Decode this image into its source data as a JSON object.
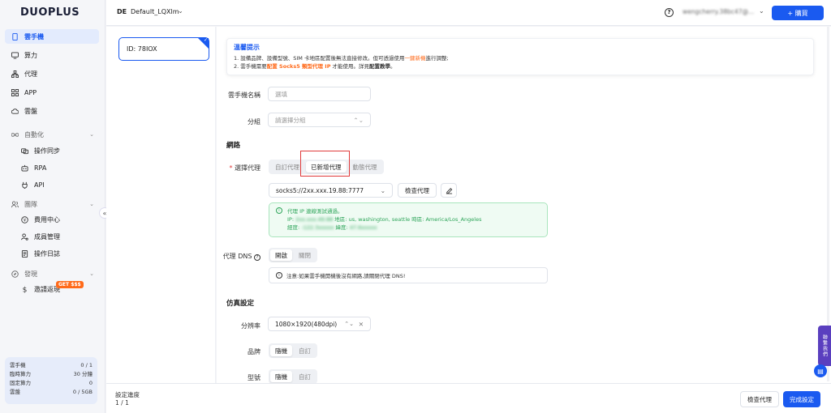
{
  "app": {
    "logo": "DUOPLUS"
  },
  "sidebar": {
    "items": [
      {
        "label": "雲手機",
        "icon": "phone-icon"
      },
      {
        "label": "算力",
        "icon": "monitor-icon"
      },
      {
        "label": "代理",
        "icon": "network-icon"
      },
      {
        "label": "APP",
        "icon": "grid-icon"
      },
      {
        "label": "雲盤",
        "icon": "cloud-icon"
      }
    ],
    "groups": {
      "automation": {
        "label": "自動化",
        "items": [
          "操作同步",
          "RPA",
          "API"
        ]
      },
      "team": {
        "label": "團隊",
        "items": [
          "費用中心",
          "成員管理",
          "操作日誌"
        ]
      },
      "discover": {
        "label": "發現",
        "items": [
          "邀請返現"
        ]
      }
    },
    "badge": "GET $$$",
    "collapse_glyph": "«",
    "stats": [
      {
        "label": "雲手機",
        "value": "0 / 1"
      },
      {
        "label": "臨時算力",
        "value": "30 分鐘"
      },
      {
        "label": "固定算力",
        "value": "0"
      },
      {
        "label": "雲盤",
        "value": "0 / 5GB"
      }
    ]
  },
  "topbar": {
    "workspace_abbr": "DE",
    "workspace_name": "Default_LQXlm",
    "help_glyph": "?",
    "user_email": "wengcherry.38bc47@...",
    "buy_label": "+ 購買"
  },
  "device_list": {
    "card_label": "ID: 78IOX"
  },
  "notice": {
    "title": "溫馨提示",
    "line1_a": "1. 設備品牌、設備型號、SIM 卡地區配置後無法直接修改。但可透過使用",
    "line1_link": "一鍵新機",
    "line1_b": "進行調整;",
    "line2_a": "2. 雲手機需要",
    "line2_hl": "配置 Socks5 類型代理 IP",
    "line2_b": " 才能使用。詳見",
    "line2_link": "配置教學",
    "line2_c": "。"
  },
  "form": {
    "name_label": "雲手機名稱",
    "name_placeholder": "選填",
    "group_label": "分組",
    "group_placeholder": "請選擇分組",
    "network_title": "網路",
    "proxy_label": "選擇代理",
    "proxy_required": "*",
    "proxy_tabs": [
      "自訂代理",
      "已新增代理",
      "動態代理"
    ],
    "proxy_value": "socks5://2xx.xxx.19.88:7777",
    "check_proxy": "檢查代理",
    "proxy_result": {
      "line1": "代理 IP 連線測試通過。",
      "ip_label": "IP:",
      "ip_value": "2xx.xxx.49.88",
      "region_label": "地區:",
      "region_value": "us, washington, seattle",
      "tz_label": "時區:",
      "tz_value": "America/Los_Angeles",
      "lng_label": "經度:",
      "lng_value": "-122.3xxxxx",
      "lat_label": "緯度:",
      "lat_value": "47.6xxxxx"
    },
    "dns_label": "代理 DNS",
    "dns_options": [
      "開啟",
      "關閉"
    ],
    "dns_note": "注意:如果雲手機開機後沒有網路,請關閉代理 DNS!",
    "sim_title": "仿真設定",
    "resolution_label": "分辨率",
    "resolution_value": "1080×1920(480dpi)",
    "brand_label": "品牌",
    "brand_options": [
      "隨機",
      "自訂"
    ],
    "model_label": "型號",
    "model_options": [
      "隨機",
      "自訂"
    ]
  },
  "footer": {
    "progress_label": "設定進度",
    "progress_value": "1 / 1",
    "check_proxy": "檢查代理",
    "finish": "完成設定"
  },
  "float": {
    "contact": "聯繫我們"
  },
  "colors": {
    "primary": "#1a5af0",
    "accent": "#ff6a1a",
    "success": "#2ea55a"
  }
}
